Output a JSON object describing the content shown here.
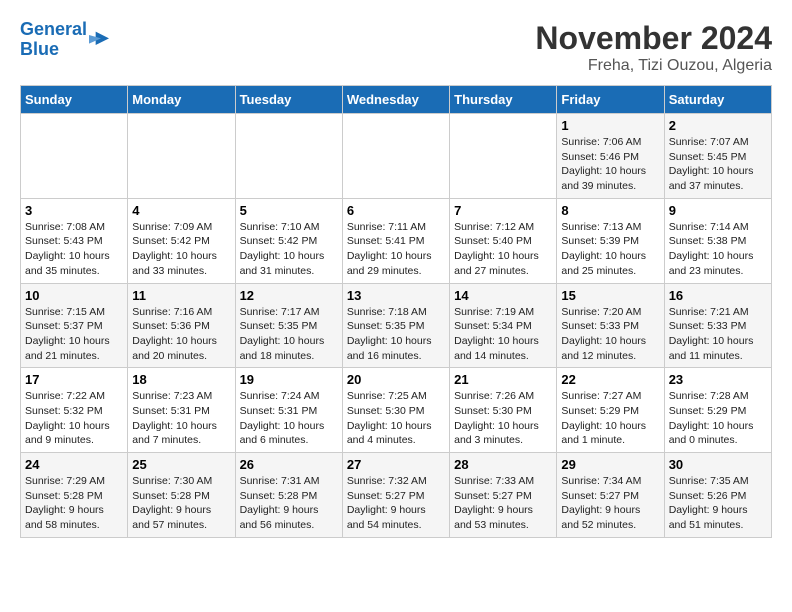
{
  "header": {
    "logo_line1": "General",
    "logo_line2": "Blue",
    "month": "November 2024",
    "location": "Freha, Tizi Ouzou, Algeria"
  },
  "weekdays": [
    "Sunday",
    "Monday",
    "Tuesday",
    "Wednesday",
    "Thursday",
    "Friday",
    "Saturday"
  ],
  "weeks": [
    [
      {
        "day": "",
        "info": ""
      },
      {
        "day": "",
        "info": ""
      },
      {
        "day": "",
        "info": ""
      },
      {
        "day": "",
        "info": ""
      },
      {
        "day": "",
        "info": ""
      },
      {
        "day": "1",
        "info": "Sunrise: 7:06 AM\nSunset: 5:46 PM\nDaylight: 10 hours and 39 minutes."
      },
      {
        "day": "2",
        "info": "Sunrise: 7:07 AM\nSunset: 5:45 PM\nDaylight: 10 hours and 37 minutes."
      }
    ],
    [
      {
        "day": "3",
        "info": "Sunrise: 7:08 AM\nSunset: 5:43 PM\nDaylight: 10 hours and 35 minutes."
      },
      {
        "day": "4",
        "info": "Sunrise: 7:09 AM\nSunset: 5:42 PM\nDaylight: 10 hours and 33 minutes."
      },
      {
        "day": "5",
        "info": "Sunrise: 7:10 AM\nSunset: 5:42 PM\nDaylight: 10 hours and 31 minutes."
      },
      {
        "day": "6",
        "info": "Sunrise: 7:11 AM\nSunset: 5:41 PM\nDaylight: 10 hours and 29 minutes."
      },
      {
        "day": "7",
        "info": "Sunrise: 7:12 AM\nSunset: 5:40 PM\nDaylight: 10 hours and 27 minutes."
      },
      {
        "day": "8",
        "info": "Sunrise: 7:13 AM\nSunset: 5:39 PM\nDaylight: 10 hours and 25 minutes."
      },
      {
        "day": "9",
        "info": "Sunrise: 7:14 AM\nSunset: 5:38 PM\nDaylight: 10 hours and 23 minutes."
      }
    ],
    [
      {
        "day": "10",
        "info": "Sunrise: 7:15 AM\nSunset: 5:37 PM\nDaylight: 10 hours and 21 minutes."
      },
      {
        "day": "11",
        "info": "Sunrise: 7:16 AM\nSunset: 5:36 PM\nDaylight: 10 hours and 20 minutes."
      },
      {
        "day": "12",
        "info": "Sunrise: 7:17 AM\nSunset: 5:35 PM\nDaylight: 10 hours and 18 minutes."
      },
      {
        "day": "13",
        "info": "Sunrise: 7:18 AM\nSunset: 5:35 PM\nDaylight: 10 hours and 16 minutes."
      },
      {
        "day": "14",
        "info": "Sunrise: 7:19 AM\nSunset: 5:34 PM\nDaylight: 10 hours and 14 minutes."
      },
      {
        "day": "15",
        "info": "Sunrise: 7:20 AM\nSunset: 5:33 PM\nDaylight: 10 hours and 12 minutes."
      },
      {
        "day": "16",
        "info": "Sunrise: 7:21 AM\nSunset: 5:33 PM\nDaylight: 10 hours and 11 minutes."
      }
    ],
    [
      {
        "day": "17",
        "info": "Sunrise: 7:22 AM\nSunset: 5:32 PM\nDaylight: 10 hours and 9 minutes."
      },
      {
        "day": "18",
        "info": "Sunrise: 7:23 AM\nSunset: 5:31 PM\nDaylight: 10 hours and 7 minutes."
      },
      {
        "day": "19",
        "info": "Sunrise: 7:24 AM\nSunset: 5:31 PM\nDaylight: 10 hours and 6 minutes."
      },
      {
        "day": "20",
        "info": "Sunrise: 7:25 AM\nSunset: 5:30 PM\nDaylight: 10 hours and 4 minutes."
      },
      {
        "day": "21",
        "info": "Sunrise: 7:26 AM\nSunset: 5:30 PM\nDaylight: 10 hours and 3 minutes."
      },
      {
        "day": "22",
        "info": "Sunrise: 7:27 AM\nSunset: 5:29 PM\nDaylight: 10 hours and 1 minute."
      },
      {
        "day": "23",
        "info": "Sunrise: 7:28 AM\nSunset: 5:29 PM\nDaylight: 10 hours and 0 minutes."
      }
    ],
    [
      {
        "day": "24",
        "info": "Sunrise: 7:29 AM\nSunset: 5:28 PM\nDaylight: 9 hours and 58 minutes."
      },
      {
        "day": "25",
        "info": "Sunrise: 7:30 AM\nSunset: 5:28 PM\nDaylight: 9 hours and 57 minutes."
      },
      {
        "day": "26",
        "info": "Sunrise: 7:31 AM\nSunset: 5:28 PM\nDaylight: 9 hours and 56 minutes."
      },
      {
        "day": "27",
        "info": "Sunrise: 7:32 AM\nSunset: 5:27 PM\nDaylight: 9 hours and 54 minutes."
      },
      {
        "day": "28",
        "info": "Sunrise: 7:33 AM\nSunset: 5:27 PM\nDaylight: 9 hours and 53 minutes."
      },
      {
        "day": "29",
        "info": "Sunrise: 7:34 AM\nSunset: 5:27 PM\nDaylight: 9 hours and 52 minutes."
      },
      {
        "day": "30",
        "info": "Sunrise: 7:35 AM\nSunset: 5:26 PM\nDaylight: 9 hours and 51 minutes."
      }
    ]
  ]
}
